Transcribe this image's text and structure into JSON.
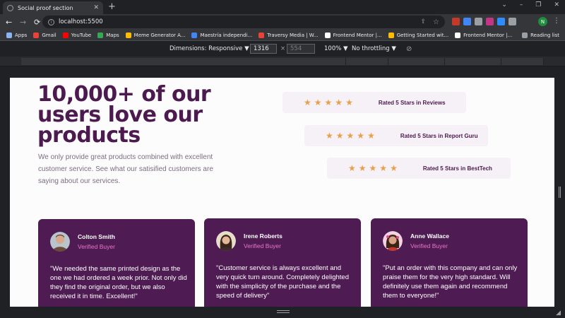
{
  "browser": {
    "tab_title": "Social proof section",
    "tab_close": "✕",
    "new_tab": "+",
    "window_controls": [
      "⌄",
      "–",
      "❐",
      "✕"
    ],
    "url": "localhost:5500",
    "back": "←",
    "forward": "→",
    "reload": "⟳",
    "share_icon": "⇪",
    "star_icon": "☆",
    "profile_initial": "N",
    "menu_icon": "⋮",
    "extensions": [
      {
        "name": "ext-red",
        "color": "#c53929"
      },
      {
        "name": "ext-translate",
        "color": "#4285f4"
      },
      {
        "name": "ext-gray",
        "color": "#9aa0a6"
      },
      {
        "name": "ext-instagram",
        "color": "#c13584"
      },
      {
        "name": "ext-zoom",
        "color": "#2d8cff"
      },
      {
        "name": "ext-puzzle",
        "color": "#9aa0a6"
      }
    ]
  },
  "bookmarks": {
    "items": [
      {
        "label": "Apps",
        "color": "#8ab4f8"
      },
      {
        "label": "Gmail",
        "color": "#ea4335"
      },
      {
        "label": "YouTube",
        "color": "#ff0000"
      },
      {
        "label": "Maps",
        "color": "#34a853"
      },
      {
        "label": "Meme Generator A...",
        "color": "#fbbc04"
      },
      {
        "label": "Maestría independi...",
        "color": "#4285f4"
      },
      {
        "label": "Traversy Media | W...",
        "color": "#ea4335"
      },
      {
        "label": "Frontend Mentor |...",
        "color": "#ffffff"
      },
      {
        "label": "Getting Started wit...",
        "color": "#fbbc04"
      },
      {
        "label": "Frontend Mentor |...",
        "color": "#ffffff"
      }
    ],
    "reading_list": "Reading list"
  },
  "devtools": {
    "dimensions_label": "Dimensions: Responsive ▼",
    "width": "1316",
    "times": "×",
    "height": "554",
    "zoom": "100% ▼",
    "throttle": "No throttling ▼",
    "rotate_icon": "⊘"
  },
  "page": {
    "headline": "10,000+ of our users love our products",
    "lead": "We only provide great products combined with excellent customer service. See what our satisified customers are saying about our services.",
    "star": "★",
    "ratings": [
      {
        "text": "Rated 5 Stars in Reviews",
        "stars": 5
      },
      {
        "text": "Rated 5 Stars in Report Guru",
        "stars": 5
      },
      {
        "text": "Rated 5 Stars in BestTech",
        "stars": 5
      }
    ],
    "testimonials": [
      {
        "name": "Colton Smith",
        "badge": "Verified Buyer",
        "quote": "\"We needed the same printed design as the one we had ordered a week prior. Not only did they find the original order, but we also received it in time. Excellent!\""
      },
      {
        "name": "Irene Roberts",
        "badge": "Verified Buyer",
        "quote": "\"Customer service is always excellent and very quick turn around. Completely delighted with the simplicity of the purchase and the speed of delivery\""
      },
      {
        "name": "Anne Wallace",
        "badge": "Verified Buyer",
        "quote": "\"Put an order with this company and can only praise them for the very high standard. Will definitely use them again and recommend them to everyone!\""
      }
    ],
    "colors": {
      "primary": "#4d1a4f",
      "accent": "#ec76c9",
      "star": "#e7a04b",
      "card_bg": "#4e1b53",
      "rating_bg": "#f6f0f7"
    }
  }
}
